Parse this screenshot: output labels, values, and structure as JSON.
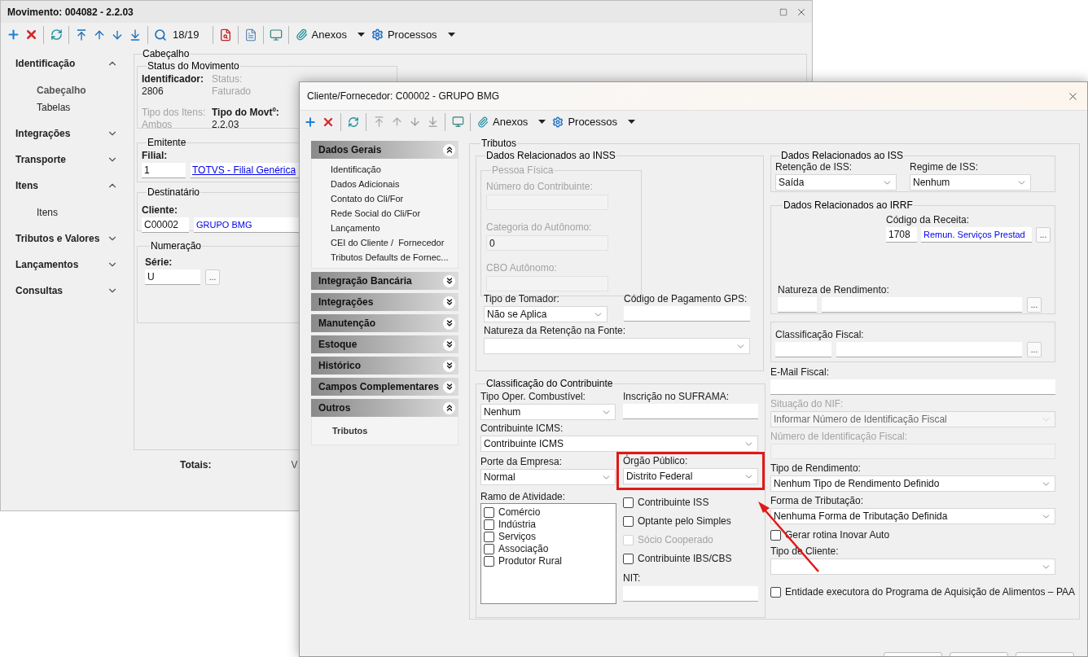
{
  "main_window": {
    "title": "Movimento: 004082 - 2.2.03",
    "toolbar": {
      "record_position": "18/19",
      "menus": [
        "Anexos",
        "Processos"
      ]
    },
    "nav": [
      {
        "label": "Identificação",
        "expanded": true,
        "children": [
          {
            "label": "Cabeçalho",
            "selected": true
          },
          {
            "label": "Tabelas",
            "selected": false
          }
        ]
      },
      {
        "label": "Integrações",
        "expanded": false
      },
      {
        "label": "Transporte",
        "expanded": false
      },
      {
        "label": "Itens",
        "expanded": true,
        "children": [
          {
            "label": "Itens",
            "selected": false
          }
        ]
      },
      {
        "label": "Tributos e Valores",
        "expanded": false
      },
      {
        "label": "Lançamentos",
        "expanded": false
      },
      {
        "label": "Consultas",
        "expanded": false
      }
    ],
    "content": {
      "title": "Cabeçalho",
      "status": {
        "title": "Status do Movimento",
        "fields": [
          {
            "label": "Identificador:",
            "value": "2806",
            "disabled": false
          },
          {
            "label": "Status:",
            "value": "Faturado",
            "disabled": true
          },
          {
            "label": "Tipo dos Itens:",
            "value": "Ambos",
            "disabled": true
          },
          {
            "label": "Tipo do Movtº:",
            "value": "2.2.03",
            "disabled": false
          }
        ]
      },
      "emitente": {
        "title": "Emitente",
        "label": "Filial:",
        "code": "1",
        "name": "TOTVS - Filial Genérica"
      },
      "destinatario": {
        "title": "Destinatário",
        "label": "Cliente:",
        "code": "C00002",
        "name": "GRUPO BMG"
      },
      "numeracao": {
        "title": "Numeração",
        "label": "Série:",
        "value": "U",
        "button": "..."
      },
      "totals_label": "Totais:",
      "totals_column_2": "V"
    }
  },
  "dialog": {
    "title": "Cliente/Fornecedor: C00002 - GRUPO BMG",
    "toolbar": {
      "menus": [
        "Anexos",
        "Processos"
      ]
    },
    "accordion": [
      {
        "label": "Dados Gerais",
        "expanded": true,
        "items": [
          {
            "label": "Identificação",
            "selected": false
          },
          {
            "label": "Dados Adicionais",
            "selected": false
          },
          {
            "label": "Contato do Cli/For",
            "selected": false
          },
          {
            "label": "Rede Social do Cli/For",
            "selected": false
          },
          {
            "label": "Lançamento",
            "selected": false
          },
          {
            "label": "CEI do Cliente /  Fornecedor",
            "selected": false
          },
          {
            "label": "Tributos Defaults de Fornec...",
            "selected": false
          }
        ]
      },
      {
        "label": "Integração Bancária",
        "expanded": false
      },
      {
        "label": "Integrações",
        "expanded": false
      },
      {
        "label": "Manutenção",
        "expanded": false
      },
      {
        "label": "Estoque",
        "expanded": false
      },
      {
        "label": "Histórico",
        "expanded": false
      },
      {
        "label": "Campos Complementares",
        "expanded": false
      },
      {
        "label": "Outros",
        "expanded": true,
        "items": [
          {
            "label": "Tributos",
            "selected": true
          }
        ]
      }
    ],
    "tributos": {
      "title": "Tributos",
      "inss": {
        "title": "Dados Relacionados ao INSS",
        "pessoa_fisica": {
          "title": "Pessoa Física",
          "disabled": true,
          "fields": [
            {
              "label": "Número do Contribuinte:"
            },
            {
              "label": "Categoria do Autônomo:",
              "value": "0"
            },
            {
              "label": "CBO Autônomo:"
            }
          ]
        },
        "tipo_tomador": {
          "label": "Tipo de Tomador:",
          "value": "Não se Aplica"
        },
        "codigo_gps": {
          "label": "Código de Pagamento GPS:"
        },
        "natureza_retencao": {
          "label": "Natureza da Retenção na Fonte:"
        }
      },
      "classificacao": {
        "title": "Classificação do Contribuinte",
        "tipo_oper": {
          "label": "Tipo Oper. Combustível:",
          "value": "Nenhum"
        },
        "suframa": {
          "label": "Inscrição no SUFRAMA:"
        },
        "icms": {
          "label": "Contribuinte ICMS:",
          "value": "Contribuinte ICMS"
        },
        "porte": {
          "label": "Porte da Empresa:",
          "value": "Normal"
        },
        "orgao": {
          "label": "Órgão Público:",
          "value": "Distrito Federal",
          "highlighted": true
        },
        "ramo": {
          "label": "Ramo de Atividade:",
          "options": [
            {
              "label": "Comércio",
              "checked": false
            },
            {
              "label": "Indústria",
              "checked": false
            },
            {
              "label": "Serviços",
              "checked": false
            },
            {
              "label": "Associação",
              "checked": false
            },
            {
              "label": "Produtor Rural",
              "checked": false
            }
          ]
        },
        "flags": [
          {
            "label": "Contribuinte ISS",
            "checked": false,
            "disabled": false
          },
          {
            "label": "Optante pelo Simples",
            "checked": false,
            "disabled": false
          },
          {
            "label": "Sócio Cooperado",
            "checked": false,
            "disabled": true
          },
          {
            "label": "Contribuinte IBS/CBS",
            "checked": false,
            "disabled": false
          }
        ],
        "nit": {
          "label": "NIT:"
        }
      },
      "iss": {
        "title": "Dados Relacionados ao ISS",
        "fields": [
          {
            "label": "Retenção de ISS:",
            "value": "Saída"
          },
          {
            "label": "Regime de ISS:",
            "value": "Nenhum"
          }
        ]
      },
      "irrf": {
        "title": "Dados Relacionados ao IRRF",
        "codigo_receita": {
          "label": "Código da Receita:",
          "code": "1708",
          "name": "Remun. Serviços Prestad",
          "button": "..."
        },
        "natureza": {
          "label": "Natureza de Rendimento:",
          "button": "..."
        }
      },
      "classificacao_fiscal": {
        "label": "Classificação Fiscal:",
        "button": "..."
      },
      "fields": [
        {
          "kind": "input",
          "label": "E-Mail Fiscal:",
          "disabled": false
        },
        {
          "kind": "select",
          "label": "Situação do NIF:",
          "value": "Informar Número de Identificação Fiscal",
          "disabled": true
        },
        {
          "kind": "input",
          "label": "Número de Identificação Fiscal:",
          "disabled": true
        },
        {
          "kind": "select",
          "label": "Tipo de Rendimento:",
          "value": "Nenhum Tipo de Rendimento Definido",
          "disabled": false
        },
        {
          "kind": "select",
          "label": "Forma de Tributação:",
          "value": "Nenhuma Forma de Tributação Definida",
          "disabled": false
        },
        {
          "kind": "checkbox",
          "label": "Gerar rotina Inovar Auto",
          "checked": false,
          "disabled": false
        },
        {
          "kind": "select",
          "label": "Tipo de Cliente:",
          "disabled": false
        },
        {
          "kind": "checkbox",
          "label": "Entidade executora do Programa de Aquisição de Alimentos – PAA",
          "checked": false,
          "disabled": false
        }
      ]
    }
  }
}
